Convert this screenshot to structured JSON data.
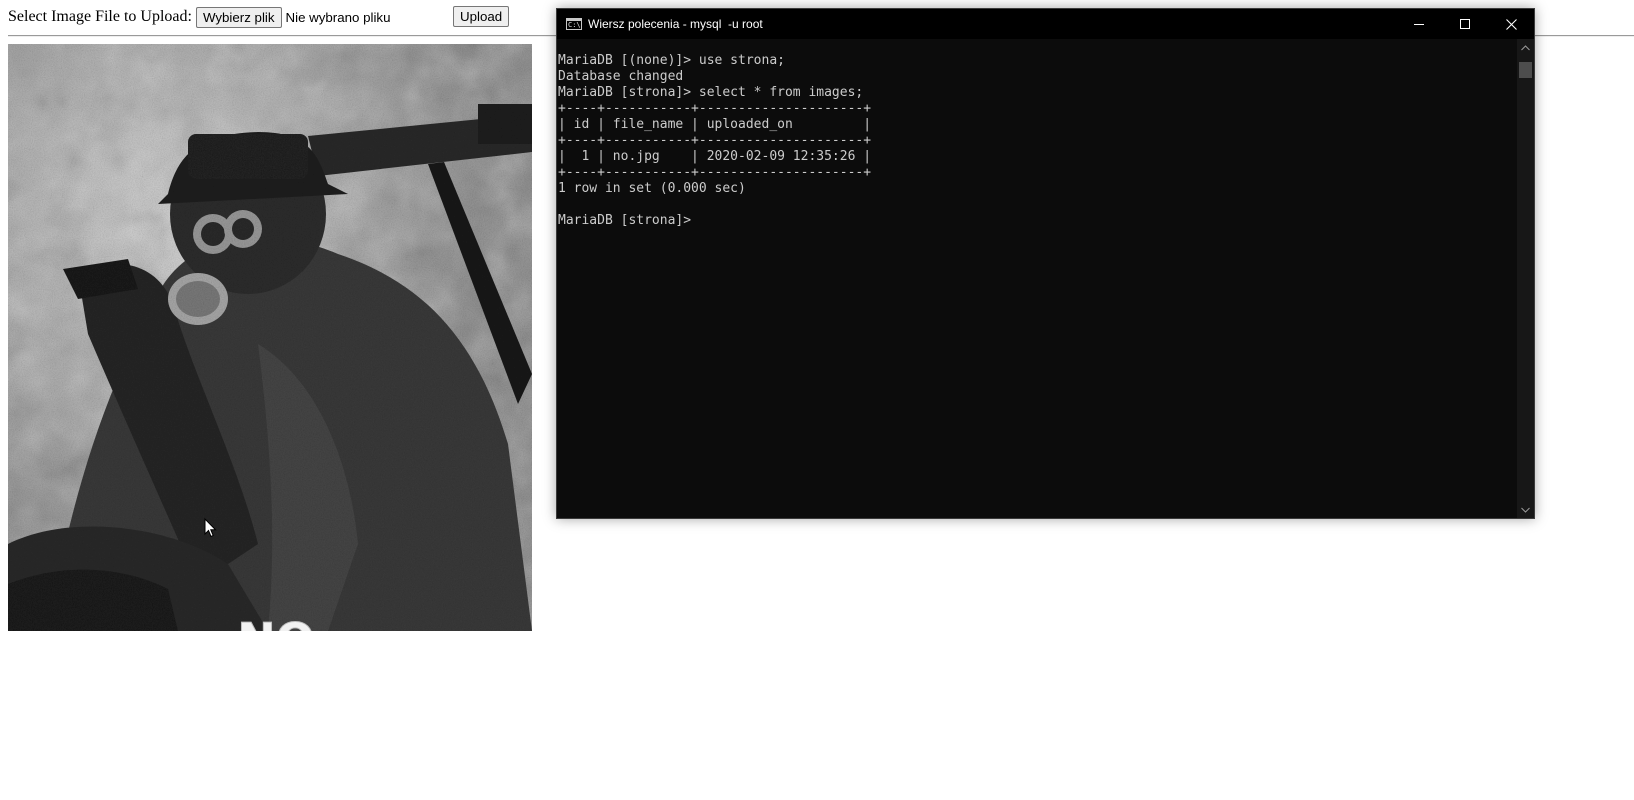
{
  "form": {
    "label": "Select Image File to Upload:",
    "choose_file_button": "Wybierz plik",
    "file_status": "Nie wybrano pliku",
    "upload_button": "Upload"
  },
  "uploaded_image": {
    "caption_text": "NO",
    "description_icon": "image-icon"
  },
  "console": {
    "title": "Wiersz polecenia - mysql  -u root",
    "icon": "command-prompt-icon",
    "icon_glyph": "C:\\",
    "controls": {
      "minimize": "minimize-icon",
      "maximize": "maximize-icon",
      "close": "close-icon"
    },
    "lines": [
      "MariaDB [(none)]> use strona;",
      "Database changed",
      "MariaDB [strona]> select * from images;",
      "+----+-----------+---------------------+",
      "| id | file_name | uploaded_on         |",
      "+----+-----------+---------------------+",
      "|  1 | no.jpg    | 2020-02-09 12:35:26 |",
      "+----+-----------+---------------------+",
      "1 row in set (0.000 sec)",
      "",
      "MariaDB [strona]>"
    ],
    "query_result": {
      "columns": [
        "id",
        "file_name",
        "uploaded_on"
      ],
      "rows": [
        [
          "1",
          "no.jpg",
          "2020-02-09 12:35:26"
        ]
      ],
      "summary": "1 row in set (0.000 sec)"
    }
  },
  "colors": {
    "console_background": "#0c0c0c",
    "console_text": "#cccccc",
    "titlebar": "#000000",
    "page_background": "#ffffff"
  }
}
